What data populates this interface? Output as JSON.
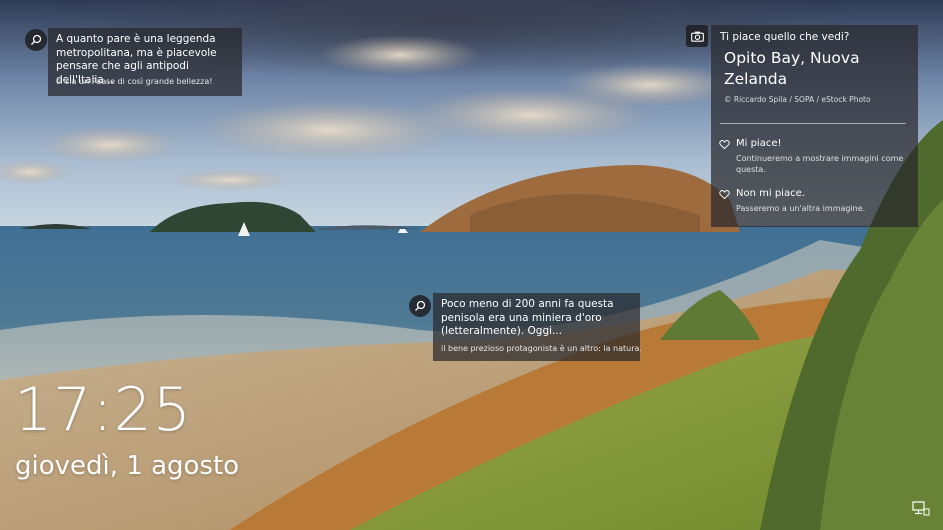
{
  "lock_screen": {
    "time": "17:25",
    "date": "giovedì, 1 agosto"
  },
  "facts": [
    {
      "text": "A quanto pare è una leggenda metropolitana, ma è piacevole pensare che agli antipodi dell'Italia...",
      "subtext": "ci sia un Paese di così grande bellezza!",
      "icon": "search-icon"
    },
    {
      "text": "Poco meno di 200 anni fa questa penisola era una miniera d'oro (letteralmente). Oggi...",
      "subtext": "il bene prezioso protagonista è un altro: la natura.",
      "icon": "search-icon"
    }
  ],
  "spotlight": {
    "question": "Ti piace quello che vedi?",
    "location": "Opito Bay, Nuova Zelanda",
    "credit": "© Riccardo Spila / SOPA / eStock Photo",
    "like": {
      "title": "Mi piace!",
      "description": "Continueremo a mostrare immagini come questa."
    },
    "dislike": {
      "title": "Non mi piace.",
      "description": "Passeremo a un'altra immagine."
    },
    "icon": "camera-icon"
  },
  "system": {
    "network_icon": "network-icon"
  }
}
